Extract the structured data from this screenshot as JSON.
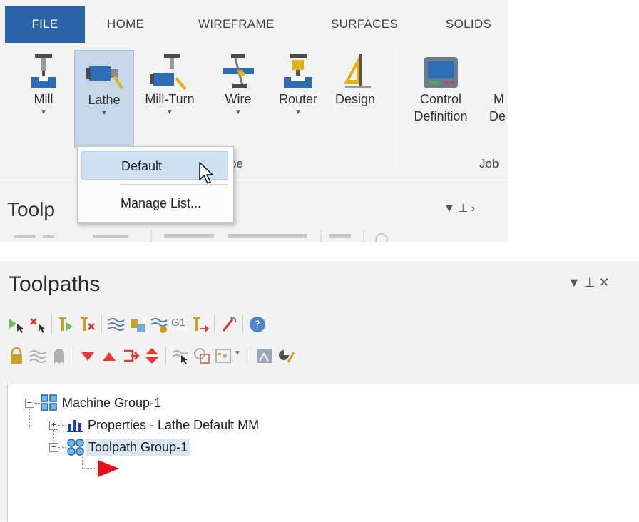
{
  "ribbon": {
    "tabs": [
      "FILE",
      "HOME",
      "WIREFRAME",
      "SURFACES",
      "SOLIDS"
    ],
    "buttons": {
      "mill": "Mill",
      "lathe": "Lathe",
      "millturn": "Mill-Turn",
      "wire": "Wire",
      "router": "Router",
      "design": "Design",
      "control_l1": "Control",
      "control_l2": "Definition",
      "machine_l1": "M",
      "machine_l2": "De"
    },
    "group_labels": [
      "pe",
      "Job"
    ]
  },
  "lathe_menu": {
    "items": [
      "Default",
      "Manage List..."
    ]
  },
  "toolpaths_panel_partial": {
    "title": "Toolp",
    "controls": "▼  ⊥  ›"
  },
  "toolpaths_panel": {
    "title": "Toolpaths",
    "controls": "▼  ⊥  ✕",
    "icon_text": {
      "g1": "G1"
    },
    "tree": {
      "machine_group": "Machine Group-1",
      "properties": "Properties - Lathe Default MM",
      "toolpath_group": "Toolpath Group-1"
    }
  },
  "colors": {
    "file_tab": "#2a62a8",
    "selection": "#cfe0f3",
    "run_arrow": "#e1121b"
  }
}
